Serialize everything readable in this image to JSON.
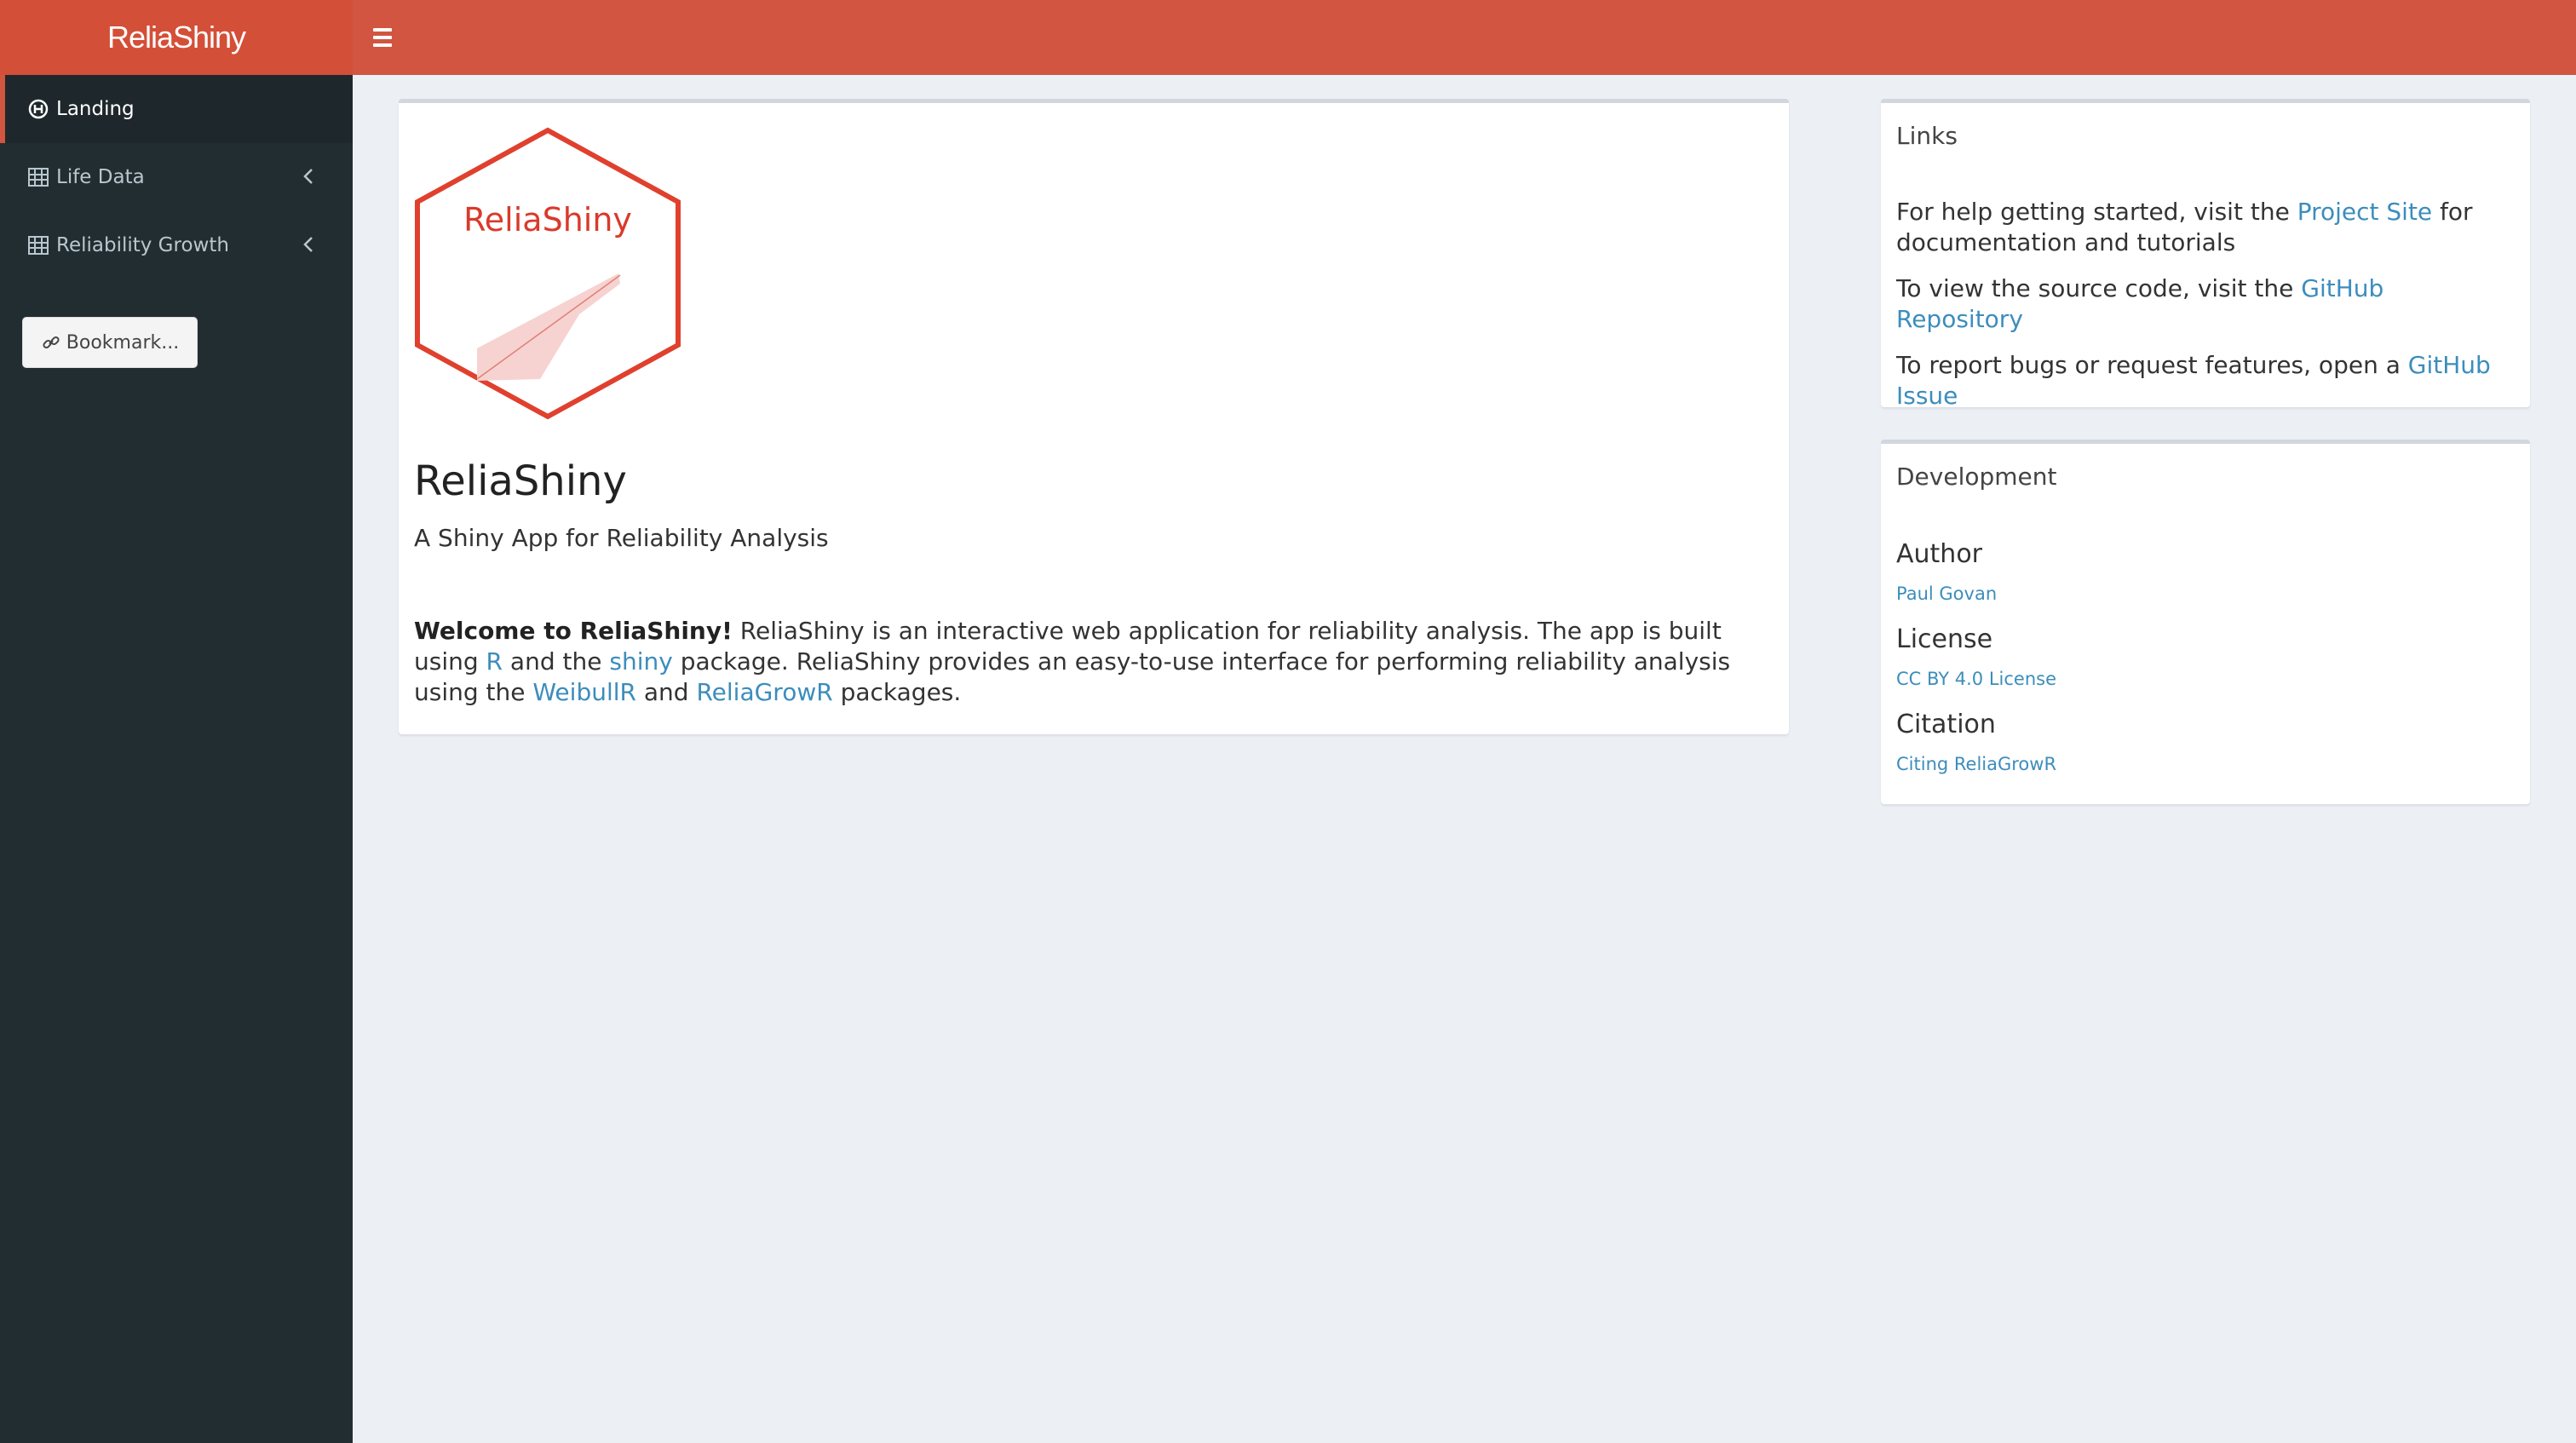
{
  "header": {
    "title": "ReliaShiny"
  },
  "sidebar": {
    "items": [
      {
        "label": "Landing"
      },
      {
        "label": "Life Data"
      },
      {
        "label": "Reliability Growth"
      }
    ],
    "bookmark_label": "Bookmark..."
  },
  "main": {
    "logo_text": "ReliaShiny",
    "title": "ReliaShiny",
    "subtitle": "A Shiny App for Reliability Analysis",
    "welcome": {
      "bold": "Welcome to ReliaShiny!",
      "t1": " ReliaShiny is an interactive web application for reliability analysis. The app is built using ",
      "link_r": "R",
      "t2": " and the ",
      "link_shiny": "shiny",
      "t3": " package. ReliaShiny provides an easy-to-use interface for performing reliability analysis using the ",
      "link_weibullr": "WeibullR",
      "t4": " and ",
      "link_reliagrowr": "ReliaGrowR",
      "t5": " packages."
    }
  },
  "links": {
    "title": "Links",
    "p1_a": "For help getting started, visit the ",
    "p1_link": "Project Site",
    "p1_b": " for documentation and tutorials",
    "p2_a": "To view the source code, visit the ",
    "p2_link": "GitHub Repository",
    "p3_a": "To report bugs or request features, open a ",
    "p3_link": "GitHub Issue"
  },
  "development": {
    "title": "Development",
    "author_label": "Author",
    "author_link": "Paul Govan",
    "license_label": "License",
    "license_link": "CC BY 4.0 License",
    "citation_label": "Citation",
    "citation_link": "Citing ReliaGrowR"
  },
  "colors": {
    "header": "#d15540",
    "logo_bg": "#d44f38",
    "sidebar": "#222d32",
    "link": "#3c8dbc",
    "background": "#ecf0f5"
  }
}
